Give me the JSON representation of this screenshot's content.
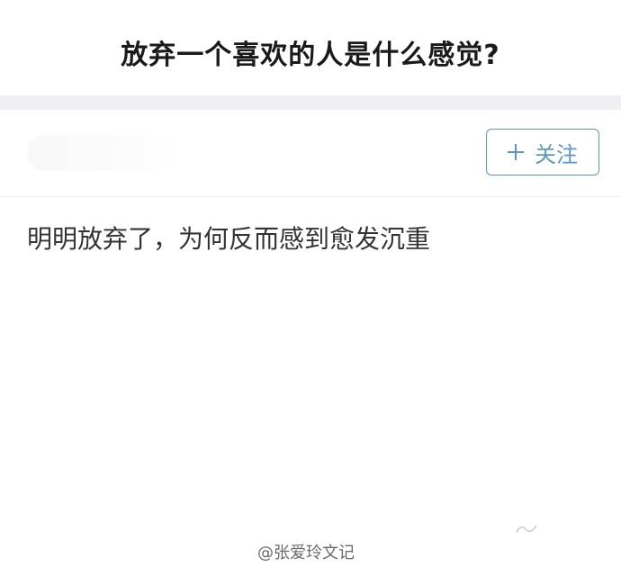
{
  "question": {
    "title": "放弃一个喜欢的人是什么感觉?"
  },
  "author_bar": {
    "follow_label": "关注",
    "follow_icon": "plus-icon"
  },
  "answer": {
    "text": "明明放弃了，为何反而感到愈发沉重"
  },
  "watermark": {
    "text": "@张爱玲文记"
  },
  "colors": {
    "accent": "#5b96c9",
    "divider": "#efeff4",
    "title": "#1a1a1a",
    "body_text": "#333333"
  }
}
